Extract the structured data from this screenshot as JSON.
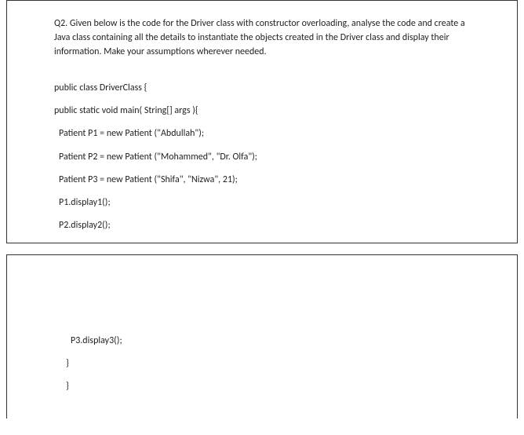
{
  "question": {
    "text": "Q2. Given below is the code for the Driver class with constructor overloading, analyse the code and create a Java class containing all the details to instantiate the objects created in the Driver class and display their information. Make your assumptions wherever needed."
  },
  "code": {
    "lines": [
      "public class DriverClass {",
      "public static void main( String[] args ){",
      "Patient P1 = new Patient (\"Abdullah\");",
      "Patient P2 = new Patient (\"Mohammed\", \"Dr. Olfa\");",
      "Patient P3 = new Patient (\"Shifa\", \"Nizwa\", 21);",
      "P1.display1();",
      "P2.display2();"
    ],
    "lines_bottom": [
      "P3.display3();",
      "}",
      "}"
    ]
  }
}
